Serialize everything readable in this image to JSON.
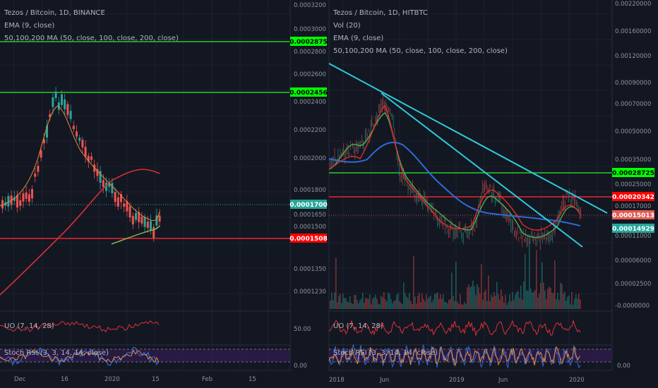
{
  "colors": {
    "bg": "#131722",
    "grid": "#1e2230",
    "red": "#f0232f",
    "green": "#2bf22b",
    "cyan": "#2ec8d8",
    "blue": "#2d6bd8",
    "orange": "#e08a3c",
    "purple": "#3a1e5c",
    "tagGreen": "#00ff00",
    "tagRed": "#ff0000",
    "tagTeal": "#26a69a",
    "tagSalmon": "#e35b52",
    "tagBlue": "#2196f3"
  },
  "left": {
    "header": {
      "title": "Tezos / Bitcoin, 1D, BINANCE",
      "ind1": "EMA (9, close)",
      "ind2": "50,100,200 MA (50, close, 100, close, 200, close)"
    },
    "price_axis": [
      "0.0003200",
      "0.0003000",
      "0.0002800",
      "0.0002600",
      "0.0002400",
      "0.0002200",
      "0.0002000",
      "0.0001800",
      "0.0001650",
      "0.0001500",
      "0.0001350",
      "0.0001230"
    ],
    "tags": {
      "green_high": "0.0002875",
      "green_mid": "0.0002456",
      "current": "0.0001700",
      "red": "0.0001508"
    },
    "uo": {
      "label": "UO (7, 14, 28)",
      "axis": "50.00"
    },
    "stoch": {
      "label": "Stoch RSI (3, 3, 14, 14, close)",
      "axis": "0.00"
    },
    "time_axis": [
      "Dec",
      "16",
      "2020",
      "15",
      "Feb",
      "15"
    ]
  },
  "right": {
    "header": {
      "title": "Tezos / Bitcoin, 1D, HITBTC",
      "ind0": "Vol (20)",
      "ind1": "EMA (9, close)",
      "ind2": "50,100,200 MA (50, close, 100, close, 200, close)"
    },
    "price_axis": [
      "0.00220000",
      "0.00160000",
      "0.00120000",
      "0.00090000",
      "0.00070000",
      "0.00050000",
      "0.00035000",
      "0.00025000",
      "0.00017000",
      "0.00011000",
      "0.00006000",
      "0.00002500",
      "-0.0000000"
    ],
    "tags": {
      "green": "0.00028725",
      "red": "0.00020342",
      "current": "0.00015013",
      "blue": "0.00014929"
    },
    "uo": {
      "label": "UO (7, 14, 28)"
    },
    "stoch": {
      "label": "Stoch RSI (3, 3, 14, 14, close)",
      "axis": "0.00"
    },
    "time_axis": [
      "2018",
      "Jun",
      "2019",
      "Jun",
      "2020"
    ]
  }
}
